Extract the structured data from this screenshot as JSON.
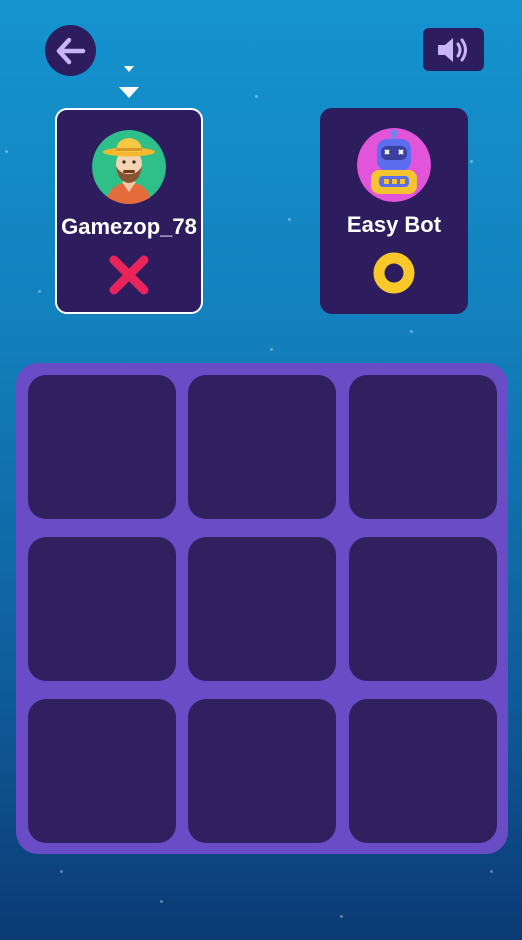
{
  "header": {
    "back_icon": "arrow-left-icon",
    "sound_icon": "speaker-volume-icon"
  },
  "turn_indicator": {
    "icon": "chevron-down-icon",
    "current_player": "player1"
  },
  "players": [
    {
      "id": "player1",
      "name": "Gamezop_78",
      "avatar": "farmer-avatar",
      "symbol": "X",
      "symbol_color": "#e8245a",
      "active": true
    },
    {
      "id": "player2",
      "name": "Easy Bot",
      "avatar": "robot-avatar",
      "symbol": "O",
      "symbol_color": "#f9c92a",
      "active": false
    }
  ],
  "board": {
    "rows": 3,
    "cols": 3,
    "cells": [
      "",
      "",
      "",
      "",
      "",
      "",
      "",
      "",
      ""
    ]
  },
  "colors": {
    "background_top": "#1594cf",
    "background_bottom": "#0b3a74",
    "card": "#2d1d5e",
    "board": "#6a4cc6",
    "cell": "#302060"
  }
}
